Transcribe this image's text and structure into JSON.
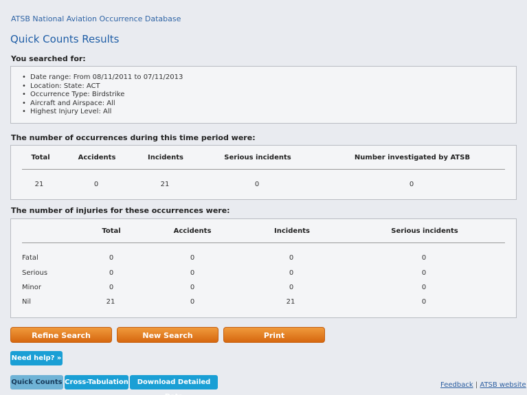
{
  "header": {
    "app_title": "ATSB National Aviation Occurrence Database",
    "page_title": "Quick Counts Results"
  },
  "search_criteria": {
    "heading": "You searched for:",
    "items": [
      "Date range: From 08/11/2011 to 07/11/2013",
      "Location: State: ACT",
      "Occurrence Type: Birdstrike",
      "Aircraft and Airspace: All",
      "Highest Injury Level: All"
    ]
  },
  "occurrences": {
    "heading": "The number of occurrences during this time period were:",
    "columns": [
      "Total",
      "Accidents",
      "Incidents",
      "Serious incidents",
      "Number investigated by ATSB"
    ],
    "values": [
      "21",
      "0",
      "21",
      "0",
      "0"
    ]
  },
  "injuries": {
    "heading": "The number of injuries for these occurrences were:",
    "columns": [
      "Total",
      "Accidents",
      "Incidents",
      "Serious incidents"
    ],
    "rows": [
      {
        "label": "Fatal",
        "values": [
          "0",
          "0",
          "0",
          "0"
        ]
      },
      {
        "label": "Serious",
        "values": [
          "0",
          "0",
          "0",
          "0"
        ]
      },
      {
        "label": "Minor",
        "values": [
          "0",
          "0",
          "0",
          "0"
        ]
      },
      {
        "label": "Nil",
        "values": [
          "21",
          "0",
          "21",
          "0"
        ]
      }
    ]
  },
  "actions": {
    "refine": "Refine Search",
    "new": "New Search",
    "print": "Print",
    "help": "Need help? »"
  },
  "tabs": {
    "quick_counts": "Quick Counts",
    "cross_tab": "Cross-Tabulation",
    "download": "Download Detailed Data"
  },
  "footer": {
    "feedback": "Feedback",
    "separator": "|",
    "atsb_website": "ATSB website"
  },
  "colors": {
    "link_blue": "#2f64a5",
    "orange_button": "#e27c22",
    "blue_button": "#1a9fd5",
    "active_tab": "#6fb3d6"
  }
}
